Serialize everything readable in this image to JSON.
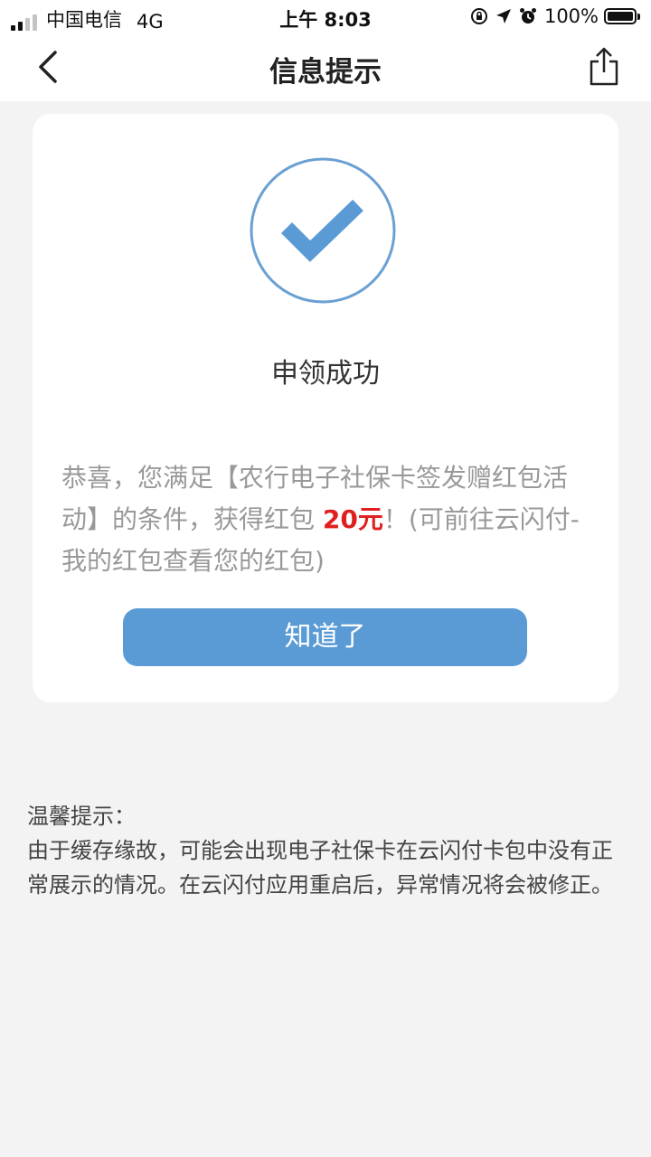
{
  "status_bar": {
    "carrier": "中国电信",
    "network": "4G",
    "time": "上午 8:03",
    "battery": "100%"
  },
  "nav": {
    "title": "信息提示"
  },
  "card": {
    "result_title": "申领成功",
    "message_prefix": "恭喜，您满足【农行电子社保卡签发赠红包活动】的条件，获得红包 ",
    "amount": "20元",
    "message_suffix": "！(可前往云闪付-我的红包查看您的红包)",
    "confirm_label": "知道了"
  },
  "tips": {
    "title": "温馨提示：",
    "body": "由于缓存缘故，可能会出现电子社保卡在云闪付卡包中没有正常展示的情况。在云闪付应用重启后，异常情况将会被修正。"
  },
  "colors": {
    "accent": "#5b9bd5",
    "amount": "#e02020",
    "background": "#f3f3f3"
  },
  "icons": [
    "signal-icon",
    "orientation-lock-icon",
    "location-arrow-icon",
    "alarm-icon",
    "battery-icon",
    "back-chevron-icon",
    "share-icon",
    "check-circle-icon"
  ]
}
